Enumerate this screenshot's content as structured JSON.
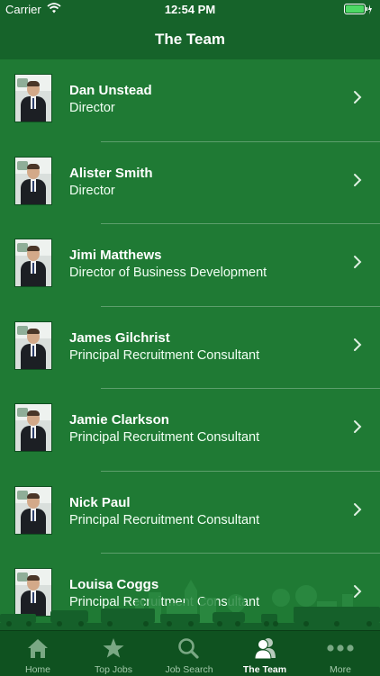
{
  "status_bar": {
    "carrier": "Carrier",
    "time": "12:54 PM"
  },
  "nav": {
    "title": "The Team"
  },
  "team": [
    {
      "name": "Dan Unstead",
      "role": "Director"
    },
    {
      "name": "Alister Smith",
      "role": "Director"
    },
    {
      "name": "Jimi Matthews",
      "role": "Director of Business Development"
    },
    {
      "name": "James Gilchrist",
      "role": "Principal Recruitment Consultant"
    },
    {
      "name": "Jamie Clarkson",
      "role": "Principal Recruitment Consultant"
    },
    {
      "name": "Nick Paul",
      "role": "Principal Recruitment Consultant"
    },
    {
      "name": "Louisa Coggs",
      "role": "Principal Recruitment Consultant"
    }
  ],
  "tabs": [
    {
      "label": "Home",
      "icon": "home-icon"
    },
    {
      "label": "Top Jobs",
      "icon": "star-icon"
    },
    {
      "label": "Job Search",
      "icon": "search-icon"
    },
    {
      "label": "The Team",
      "icon": "team-icon",
      "active": true
    },
    {
      "label": "More",
      "icon": "more-icon"
    }
  ],
  "colors": {
    "background": "#1f7a34",
    "bar": "#16632a",
    "tab_bar": "#0f5220"
  }
}
